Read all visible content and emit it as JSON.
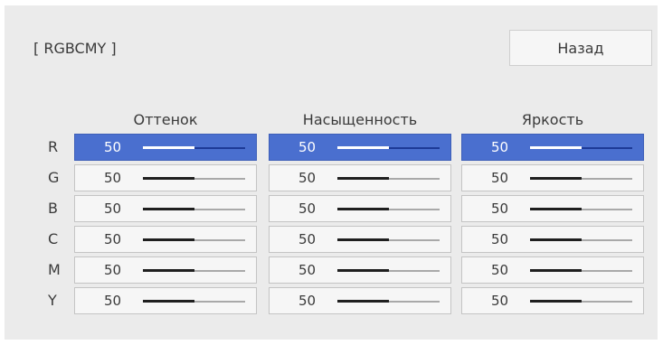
{
  "header": {
    "title": "[ RGBCMY ]",
    "back_label": "Назад"
  },
  "columns": [
    "Оттенок",
    "Насыщенность",
    "Яркость"
  ],
  "slider_range": [
    0,
    100
  ],
  "colors": {
    "selected_row": "#4a6fcf",
    "panel_background": "#ebebeb"
  },
  "rows": [
    {
      "label": "R",
      "values": [
        "50",
        "50",
        "50"
      ],
      "selected": true
    },
    {
      "label": "G",
      "values": [
        "50",
        "50",
        "50"
      ],
      "selected": false
    },
    {
      "label": "B",
      "values": [
        "50",
        "50",
        "50"
      ],
      "selected": false
    },
    {
      "label": "C",
      "values": [
        "50",
        "50",
        "50"
      ],
      "selected": false
    },
    {
      "label": "M",
      "values": [
        "50",
        "50",
        "50"
      ],
      "selected": false
    },
    {
      "label": "Y",
      "values": [
        "50",
        "50",
        "50"
      ],
      "selected": false
    }
  ]
}
